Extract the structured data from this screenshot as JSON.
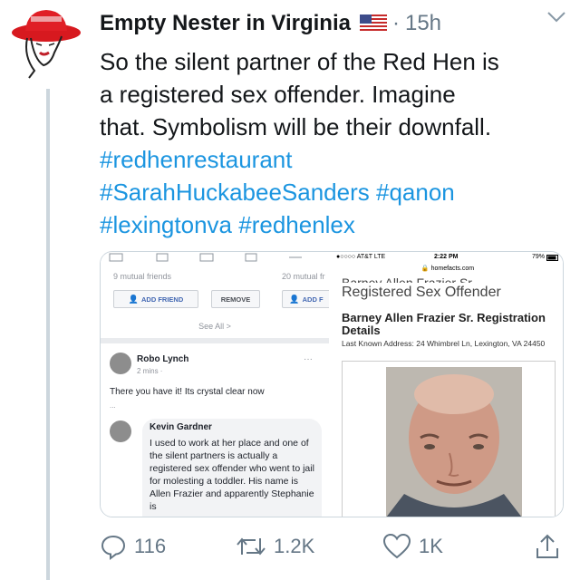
{
  "author": {
    "name": "Empty Nester in Virginia",
    "separator": "·",
    "time": "15h",
    "avatar_icon": "woman-red-hat-avatar"
  },
  "tweet": {
    "line1": "So the silent partner of the Red Hen is",
    "line2": "a registered sex offender.   Imagine",
    "line3": "that. Symbolism will be their downfall.",
    "hashtags": [
      "#redhenrestaurant",
      "#SarahHuckabeeSanders",
      "#qanon",
      "#lexingtonva",
      "#redhenlex"
    ]
  },
  "left_screenshot": {
    "mutual1": "9 mutual friends",
    "mutual2": "20 mutual fr",
    "add_friend": "ADD FRIEND",
    "remove": "REMOVE",
    "add_cut": "ADD F",
    "see_all": "See All >",
    "poster_name": "Robo Lynch",
    "poster_meta": "2 mins ·",
    "post_text": "There you have it! Its crystal clear now",
    "ellipsis": "...",
    "more": "···",
    "commenter_name": "Kevin Gardner",
    "comment_text": "I used to work at her place and one of the silent partners is actually a registered sex offender who went to jail for molesting a toddler. His name is Allen Frazier and apparently Stephanie is"
  },
  "right_screenshot": {
    "carrier": "●○○○○ AT&T  LTE",
    "time": "2:22 PM",
    "battery": "79%",
    "url": "homefacts.com",
    "cut_heading": "Barney Allen Frazier Sr.",
    "title": "Registered Sex Offender",
    "details_title": "Barney Allen Frazier Sr. Registration Details",
    "address": "Last Known Address: 24 Whimbrel Ln, Lexington, VA 24450"
  },
  "actions": {
    "replies": "116",
    "retweets": "1.2K",
    "likes": "1K"
  },
  "colors": {
    "link": "#1b95e0",
    "secondary": "#657786",
    "thread_line": "#ccd6dd"
  }
}
